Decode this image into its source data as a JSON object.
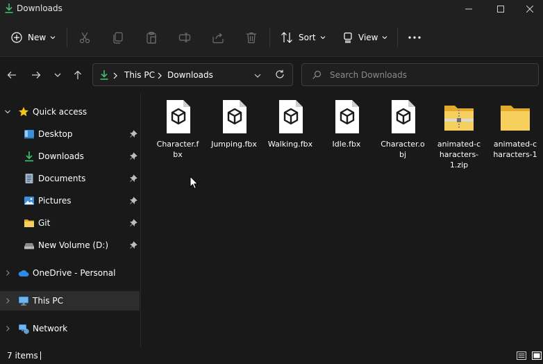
{
  "window": {
    "title": "Downloads",
    "controls": [
      "minimize-icon",
      "maximize-icon",
      "close-icon"
    ]
  },
  "commandbar": {
    "new_label": "New",
    "sort_label": "Sort",
    "view_label": "View",
    "icons": [
      "cut-icon",
      "copy-icon",
      "paste-icon",
      "rename-icon",
      "share-icon",
      "delete-icon",
      "more-icon"
    ]
  },
  "address": {
    "segments": [
      "This PC",
      "Downloads"
    ]
  },
  "search": {
    "placeholder": "Search Downloads"
  },
  "sidebar": {
    "quick_access": "Quick access",
    "items": [
      {
        "label": "Desktop",
        "icon": "desktop-icon"
      },
      {
        "label": "Downloads",
        "icon": "download-icon"
      },
      {
        "label": "Documents",
        "icon": "document-icon"
      },
      {
        "label": "Pictures",
        "icon": "pictures-icon"
      },
      {
        "label": "Git",
        "icon": "folder-icon"
      },
      {
        "label": "New Volume (D:)",
        "icon": "drive-icon"
      }
    ],
    "onedrive": "OneDrive - Personal",
    "this_pc": "This PC",
    "network": "Network"
  },
  "files": [
    {
      "name": "Character.fbx",
      "icon": "3d-object-file-icon"
    },
    {
      "name": "Jumping.fbx",
      "icon": "3d-object-file-icon"
    },
    {
      "name": "Walking.fbx",
      "icon": "3d-object-file-icon"
    },
    {
      "name": "Idle.fbx",
      "icon": "3d-object-file-icon"
    },
    {
      "name": "Character.obj",
      "icon": "3d-object-file-icon"
    },
    {
      "name": "animated-characters-1.zip",
      "icon": "zip-folder-icon"
    },
    {
      "name": "animated-characters-1",
      "icon": "folder-icon"
    }
  ],
  "status": {
    "item_count": "7 items"
  },
  "colors": {
    "accent_green": "#3fbf6f",
    "folder_yellow": "#f4c85a",
    "selected_bg": "#2d2d2d",
    "background": "#191919"
  }
}
